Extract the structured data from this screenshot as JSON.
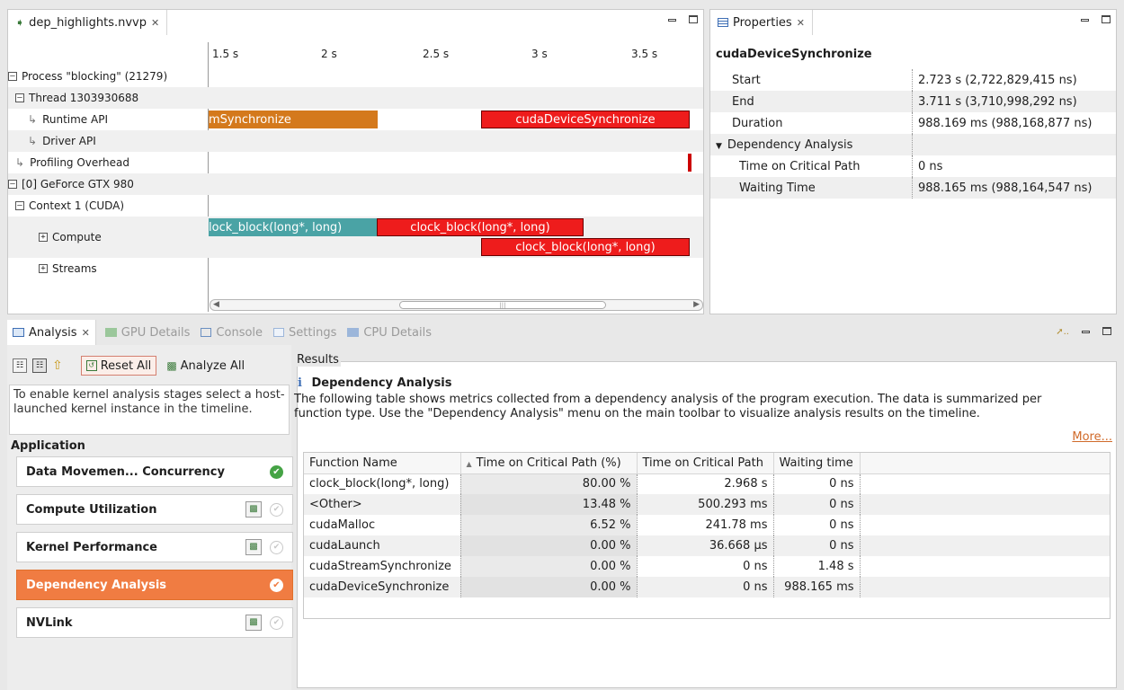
{
  "timeline": {
    "tab_title": "dep_highlights.nvvp",
    "ticks": [
      "1.5 s",
      "2 s",
      "2.5 s",
      "3 s",
      "3.5 s"
    ],
    "rows": [
      {
        "label": "Process \"blocking\" (21279)"
      },
      {
        "label": "Thread 1303930688"
      },
      {
        "label": "Runtime API"
      },
      {
        "label": "Driver API"
      },
      {
        "label": "Profiling Overhead"
      },
      {
        "label": "[0] GeForce GTX 980"
      },
      {
        "label": "Context 1 (CUDA)"
      },
      {
        "label": "Compute"
      },
      {
        "label": "Streams"
      }
    ],
    "bars": {
      "runtime_left": "mSynchronize",
      "runtime_right": "cudaDeviceSynchronize",
      "compute_left": "lock_block(long*, long)",
      "compute_mid": "clock_block(long*, long)",
      "compute_right": "clock_block(long*, long)"
    },
    "scroll_thumb": "|||"
  },
  "properties": {
    "tab_title": "Properties",
    "heading": "cudaDeviceSynchronize",
    "rows": [
      {
        "key": "Start",
        "value": "2.723 s (2,722,829,415 ns)"
      },
      {
        "key": "End",
        "value": "3.711 s (3,710,998,292 ns)"
      },
      {
        "key": "Duration",
        "value": "988.169 ms (988,168,877 ns)"
      },
      {
        "key": "Dependency Analysis",
        "value": ""
      },
      {
        "key": "Time on Critical Path",
        "value": "0 ns"
      },
      {
        "key": "Waiting Time",
        "value": "988.165 ms (988,164,547 ns)"
      }
    ]
  },
  "bottom_tabs": [
    "Analysis",
    "GPU Details",
    "Console",
    "Settings",
    "CPU Details"
  ],
  "analysis": {
    "reset_all": "Reset All",
    "analyze_all": "Analyze All",
    "hint": "To enable kernel analysis stages select a host-launched kernel instance in the timeline.",
    "section": "Application",
    "stages": [
      {
        "label": "Data Movemen... Concurrency"
      },
      {
        "label": "Compute Utilization"
      },
      {
        "label": "Kernel Performance"
      },
      {
        "label": "Dependency Analysis"
      },
      {
        "label": "NVLink"
      }
    ]
  },
  "results": {
    "group_label": "Results",
    "title": "Dependency Analysis",
    "description": "The following table shows metrics collected from a dependency analysis of the program execution. The data is summarized per function type. Use the \"Dependency Analysis\" menu on the main toolbar to visualize analysis results on the timeline.",
    "more_link": "More...",
    "columns": [
      "Function Name",
      "Time on Critical Path (%)",
      "Time on Critical Path",
      "Waiting time"
    ],
    "rows": [
      [
        "clock_block(long*, long)",
        "80.00 %",
        "2.968 s",
        "0 ns"
      ],
      [
        "<Other>",
        "13.48 %",
        "500.293 ms",
        "0 ns"
      ],
      [
        "cudaMalloc",
        "6.52 %",
        "241.78 ms",
        "0 ns"
      ],
      [
        "cudaLaunch",
        "0.00 %",
        "36.668 µs",
        "0 ns"
      ],
      [
        "cudaStreamSynchronize",
        "0.00 %",
        "0 ns",
        "1.48 s"
      ],
      [
        "cudaDeviceSynchronize",
        "0.00 %",
        "0 ns",
        "988.165 ms"
      ]
    ]
  },
  "colors": {
    "accent": "#f07c42",
    "bar_orange": "#d4791c",
    "bar_red": "#ee1c1c",
    "bar_teal": "#4aa3a5",
    "ok_green": "#45a345"
  }
}
